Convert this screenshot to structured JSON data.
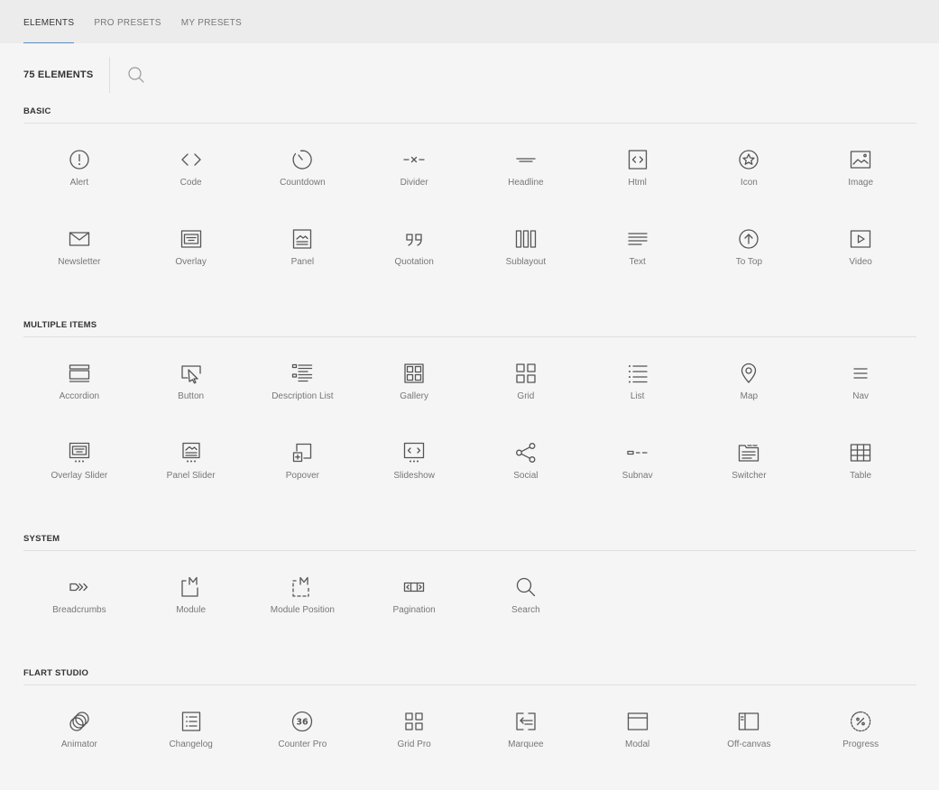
{
  "tabs": [
    {
      "label": "ELEMENTS",
      "active": true
    },
    {
      "label": "PRO PRESETS",
      "active": false
    },
    {
      "label": "MY PRESETS",
      "active": false
    }
  ],
  "count_label": "75 ELEMENTS",
  "accent_color": "#4a90d9",
  "sections": {
    "basic": {
      "title": "BASIC",
      "items": [
        {
          "label": "Alert",
          "icon": "alert-icon"
        },
        {
          "label": "Code",
          "icon": "code-icon"
        },
        {
          "label": "Countdown",
          "icon": "countdown-icon"
        },
        {
          "label": "Divider",
          "icon": "divider-icon"
        },
        {
          "label": "Headline",
          "icon": "headline-icon"
        },
        {
          "label": "Html",
          "icon": "html-icon"
        },
        {
          "label": "Icon",
          "icon": "star-icon"
        },
        {
          "label": "Image",
          "icon": "image-icon"
        },
        {
          "label": "Newsletter",
          "icon": "envelope-icon"
        },
        {
          "label": "Overlay",
          "icon": "overlay-icon"
        },
        {
          "label": "Panel",
          "icon": "panel-icon"
        },
        {
          "label": "Quotation",
          "icon": "quotation-icon"
        },
        {
          "label": "Sublayout",
          "icon": "sublayout-icon"
        },
        {
          "label": "Text",
          "icon": "text-icon"
        },
        {
          "label": "To Top",
          "icon": "to-top-icon"
        },
        {
          "label": "Video",
          "icon": "video-icon"
        }
      ]
    },
    "multiple": {
      "title": "MULTIPLE ITEMS",
      "items": [
        {
          "label": "Accordion",
          "icon": "accordion-icon"
        },
        {
          "label": "Button",
          "icon": "button-icon"
        },
        {
          "label": "Description List",
          "icon": "description-list-icon"
        },
        {
          "label": "Gallery",
          "icon": "gallery-icon"
        },
        {
          "label": "Grid",
          "icon": "grid-icon"
        },
        {
          "label": "List",
          "icon": "list-icon"
        },
        {
          "label": "Map",
          "icon": "map-pin-icon"
        },
        {
          "label": "Nav",
          "icon": "nav-icon"
        },
        {
          "label": "Overlay Slider",
          "icon": "overlay-slider-icon"
        },
        {
          "label": "Panel Slider",
          "icon": "panel-slider-icon"
        },
        {
          "label": "Popover",
          "icon": "popover-icon"
        },
        {
          "label": "Slideshow",
          "icon": "slideshow-icon"
        },
        {
          "label": "Social",
          "icon": "share-icon"
        },
        {
          "label": "Subnav",
          "icon": "subnav-icon"
        },
        {
          "label": "Switcher",
          "icon": "switcher-icon"
        },
        {
          "label": "Table",
          "icon": "table-icon"
        }
      ]
    },
    "system": {
      "title": "SYSTEM",
      "items": [
        {
          "label": "Breadcrumbs",
          "icon": "breadcrumbs-icon"
        },
        {
          "label": "Module",
          "icon": "module-icon"
        },
        {
          "label": "Module Position",
          "icon": "module-position-icon"
        },
        {
          "label": "Pagination",
          "icon": "pagination-icon"
        },
        {
          "label": "Search",
          "icon": "search-icon"
        }
      ]
    },
    "flart": {
      "title": "FLART STUDIO",
      "items": [
        {
          "label": "Animator",
          "icon": "animator-icon"
        },
        {
          "label": "Changelog",
          "icon": "changelog-icon"
        },
        {
          "label": "Counter Pro",
          "icon": "counter-pro-icon",
          "badge": "36"
        },
        {
          "label": "Grid Pro",
          "icon": "grid-pro-icon"
        },
        {
          "label": "Marquee",
          "icon": "marquee-icon"
        },
        {
          "label": "Modal",
          "icon": "modal-icon"
        },
        {
          "label": "Off-canvas",
          "icon": "off-canvas-icon"
        },
        {
          "label": "Progress",
          "icon": "progress-icon"
        }
      ]
    }
  }
}
